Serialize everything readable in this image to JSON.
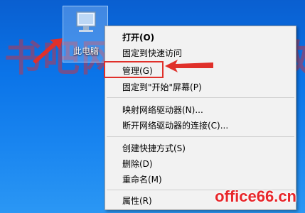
{
  "desktop": {
    "icon_label": "此电脑",
    "icon": "computer-icon"
  },
  "context_menu": {
    "items": [
      {
        "label": "打开(O)",
        "bold": true
      },
      {
        "label": "固定到快速访问"
      },
      {
        "label": "管理(G)"
      },
      {
        "label": "固定到\"开始\"屏幕(P)"
      },
      {
        "label": "映射网络驱动器(N)..."
      },
      {
        "label": "断开网络驱动器的连接(C)..."
      },
      {
        "label": "创建快捷方式(S)"
      },
      {
        "label": "删除(D)"
      },
      {
        "label": "重命名(M)"
      },
      {
        "label": "属性(R)"
      }
    ]
  },
  "annotation": {
    "highlight_color": "#e0302a",
    "highlighted_item": "管理(G)"
  },
  "watermark": {
    "text": "书吧网 office 教程网",
    "brand": "office66.cn"
  }
}
